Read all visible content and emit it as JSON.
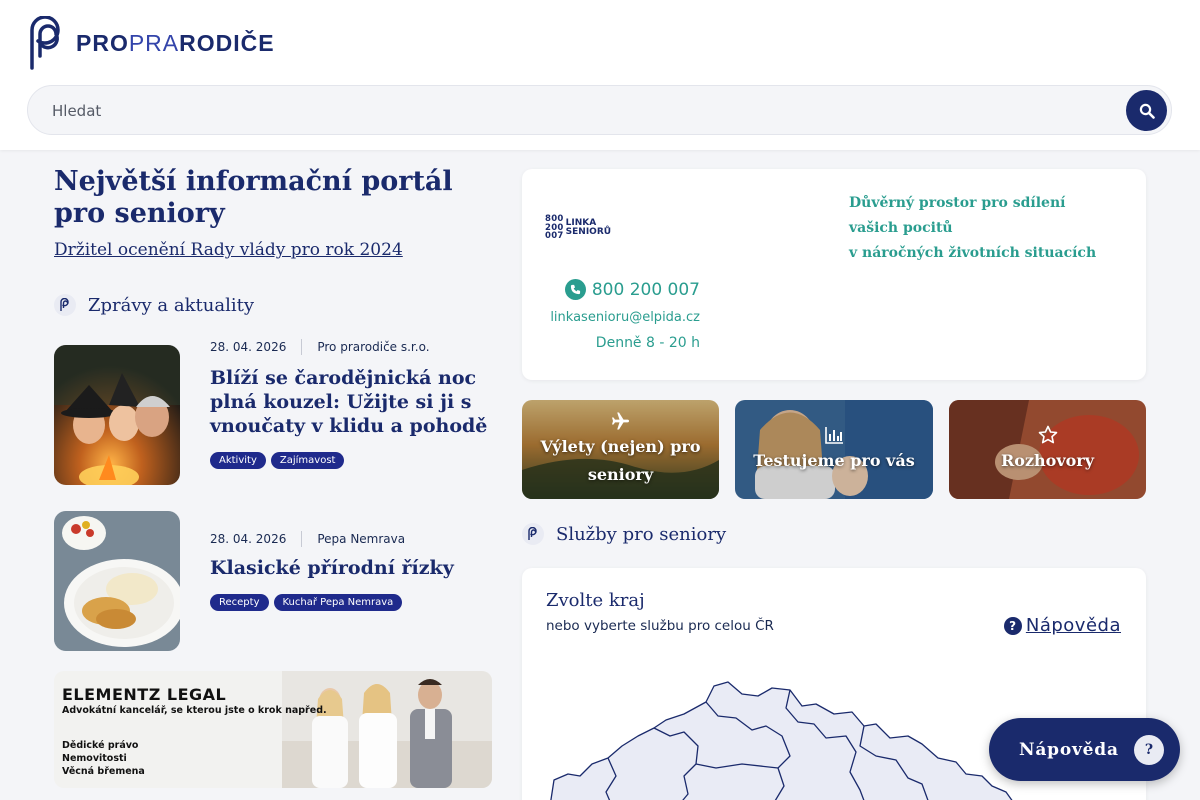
{
  "logo": {
    "text_primary": "PRO",
    "text_light": "PRA",
    "text_rest": "RODIČE"
  },
  "search": {
    "placeholder": "Hledat"
  },
  "hero": {
    "title": "Největší informační portál pro seniory",
    "subtitle": "Držitel ocenění Rady vlády pro rok 2024"
  },
  "news_section": {
    "title": "Zprávy a aktuality"
  },
  "news": [
    {
      "date": "28. 04. 2026",
      "author": "Pro prarodiče s.r.o.",
      "title": "Blíží se čarodějnická noc plná kouzel: Užijte si ji s vnoučaty v klidu a pohodě",
      "tags": [
        "Aktivity",
        "Zajímavost"
      ]
    },
    {
      "date": "28. 04. 2026",
      "author": "Pepa Nemrava",
      "title": "Klasické přírodní řízky",
      "tags": [
        "Recepty",
        "Kuchař Pepa Nemrava"
      ]
    }
  ],
  "banner": {
    "title": "ELEMENTZ LEGAL",
    "subtitle": "Advokátní kancelář, se kterou jste o krok napřed.",
    "items": [
      "Dědické právo",
      "Nemovitosti",
      "Věcná břemena"
    ]
  },
  "linka": {
    "logo_numbers": [
      "800",
      "200",
      "007"
    ],
    "logo_name": [
      "LINKA",
      "SENIORŮ"
    ],
    "phone": "800 200 007",
    "email": "linkasenioru@elpida.cz",
    "hours": "Denně 8 - 20 h",
    "description_line1": "Důvěrný prostor pro sdílení vašich pocitů",
    "description_line2": "v náročných životních situacích",
    "accent_color": "#2a9d8f"
  },
  "tiles": [
    {
      "label": "Výlety (nejen) pro seniory",
      "icon": "airplane-icon"
    },
    {
      "label": "Testujeme pro vás",
      "icon": "bar-chart-icon"
    },
    {
      "label": "Rozhovory",
      "icon": "star-icon"
    }
  ],
  "services_section": {
    "title": "Služby pro seniory"
  },
  "map_card": {
    "title": "Zvolte kraj",
    "subtitle": "nebo vyberte službu pro celou ČR",
    "help": "Nápověda"
  },
  "help_float": {
    "label": "Nápověda",
    "icon_text": "?"
  },
  "colors": {
    "brand_navy": "#1a2a6c",
    "tag_blue": "#1f2a8c",
    "teal": "#2a9d8f",
    "page_bg": "#f4f5f8"
  }
}
